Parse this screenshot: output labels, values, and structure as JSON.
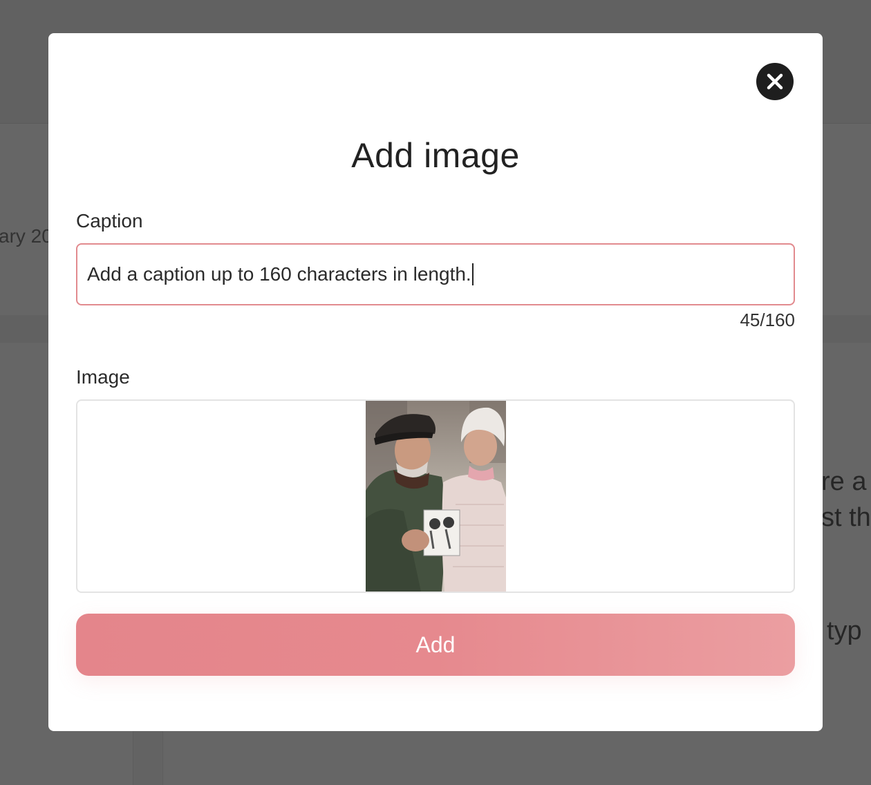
{
  "background": {
    "left_text": "ary 20",
    "right_lines": [
      "re a",
      "st th",
      "typ"
    ]
  },
  "modal": {
    "title": "Add image",
    "caption_label": "Caption",
    "caption_value": "Add a caption up to 160 characters in length.",
    "caption_counter": "45/160",
    "image_label": "Image",
    "image_alt": "Elderly couple holding an old photograph",
    "add_button_label": "Add"
  },
  "icons": {
    "close": "close-icon"
  },
  "colors": {
    "accent": "#e4858b",
    "input_border": "#e28a8e",
    "close_bg": "#1e1e1e"
  }
}
